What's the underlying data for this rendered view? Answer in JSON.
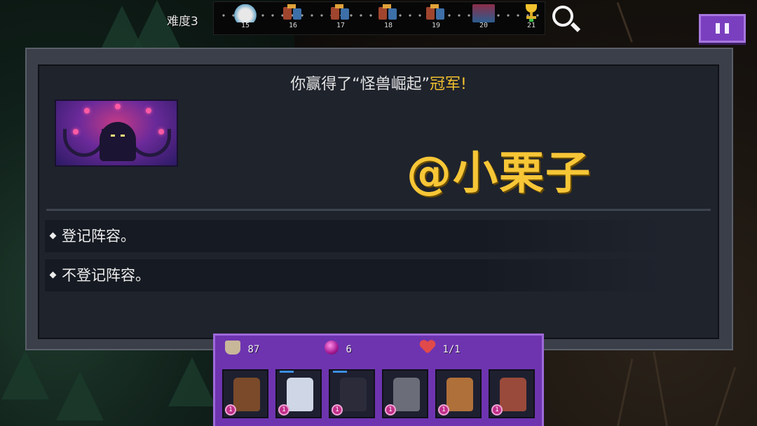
{
  "header": {
    "difficulty_label": "难度3",
    "stages": [
      {
        "num": "15",
        "icon": "cloud-stage-icon"
      },
      {
        "num": "16",
        "icon": "battle-stage-icon"
      },
      {
        "num": "17",
        "icon": "battle-stage-icon"
      },
      {
        "num": "18",
        "icon": "battle-stage-icon"
      },
      {
        "num": "19",
        "icon": "battle-stage-icon"
      },
      {
        "num": "20",
        "icon": "boss-stage-icon"
      },
      {
        "num": "21",
        "icon": "trophy-icon"
      }
    ]
  },
  "dialog": {
    "title_prefix": "你赢得了“怪兽崛起”",
    "title_highlight": "冠军!",
    "watermark": "@小栗子",
    "options": [
      {
        "label": "登记阵容。"
      },
      {
        "label": "不登记阵容。"
      }
    ]
  },
  "panel": {
    "gold": "87",
    "gems": "6",
    "lives": "1/1",
    "heroes": [
      {
        "level": "1",
        "color": "#7a4a2a"
      },
      {
        "level": "1",
        "color": "#cfd6e6"
      },
      {
        "level": "1",
        "color": "#2b2b3a"
      },
      {
        "level": "1",
        "color": "#6b6e78"
      },
      {
        "level": "1",
        "color": "#b0703a"
      },
      {
        "level": "1",
        "color": "#9a4a3a"
      }
    ]
  },
  "colors": {
    "accent_purple": "#6e34b0",
    "highlight_yellow": "#f2c12e",
    "watermark_yellow": "#f7c637"
  }
}
